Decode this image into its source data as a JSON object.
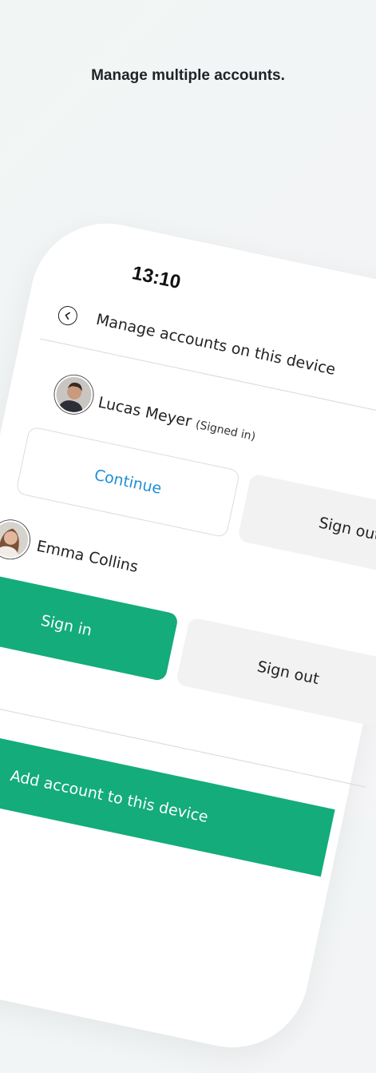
{
  "headline": "Manage multiple accounts.",
  "phone": {
    "clock": "13:10",
    "header": {
      "back_icon": "chevron-left-circle-icon",
      "title": "Manage accounts on this device"
    },
    "accounts": [
      {
        "name": "Lucas Meyer",
        "status": "(Signed in)",
        "primary_action": "Continue",
        "secondary_action": "Sign out"
      },
      {
        "name": "Emma Collins",
        "status": "",
        "primary_action": "Sign in",
        "secondary_action": "Sign out"
      }
    ],
    "add_account_label": "Add account to this device"
  },
  "colors": {
    "accent_green": "#13ac7a",
    "link_blue": "#1d8fd6",
    "gray_button": "#f2f2f3"
  }
}
